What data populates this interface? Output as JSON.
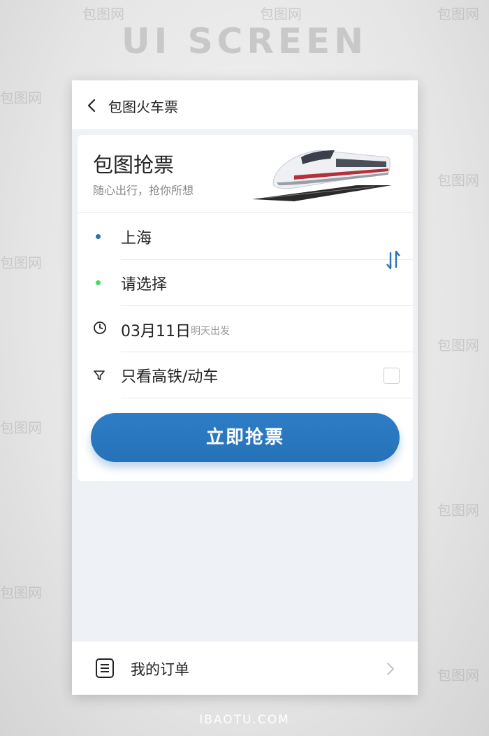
{
  "background": {
    "title": "UI SCREEN",
    "footer": "IBAOTU.COM",
    "watermark": "包图网"
  },
  "header": {
    "back_icon": "chevron-left-icon",
    "title": "包图火车票"
  },
  "card": {
    "title": "包图抢票",
    "subtitle": "随心出行，抢你所想",
    "image": "high-speed-train-image",
    "from": {
      "value": "上海",
      "dot_color": "#2672b8"
    },
    "to": {
      "value": "请选择",
      "dot_color": "#3ddc6b"
    },
    "swap_icon": "swap-arrows-icon",
    "swap_color": "#2672b8",
    "date": {
      "icon": "clock-icon",
      "value": "03月11日",
      "hint": "明天出发"
    },
    "filter": {
      "icon": "filter-icon",
      "label": "只看高铁/动车",
      "checked": false
    },
    "cta_label": "立即抢票",
    "accent": "#2672b8"
  },
  "bottom_bar": {
    "icon": "list-document-icon",
    "label": "我的订单",
    "chevron": "chevron-right-icon"
  }
}
